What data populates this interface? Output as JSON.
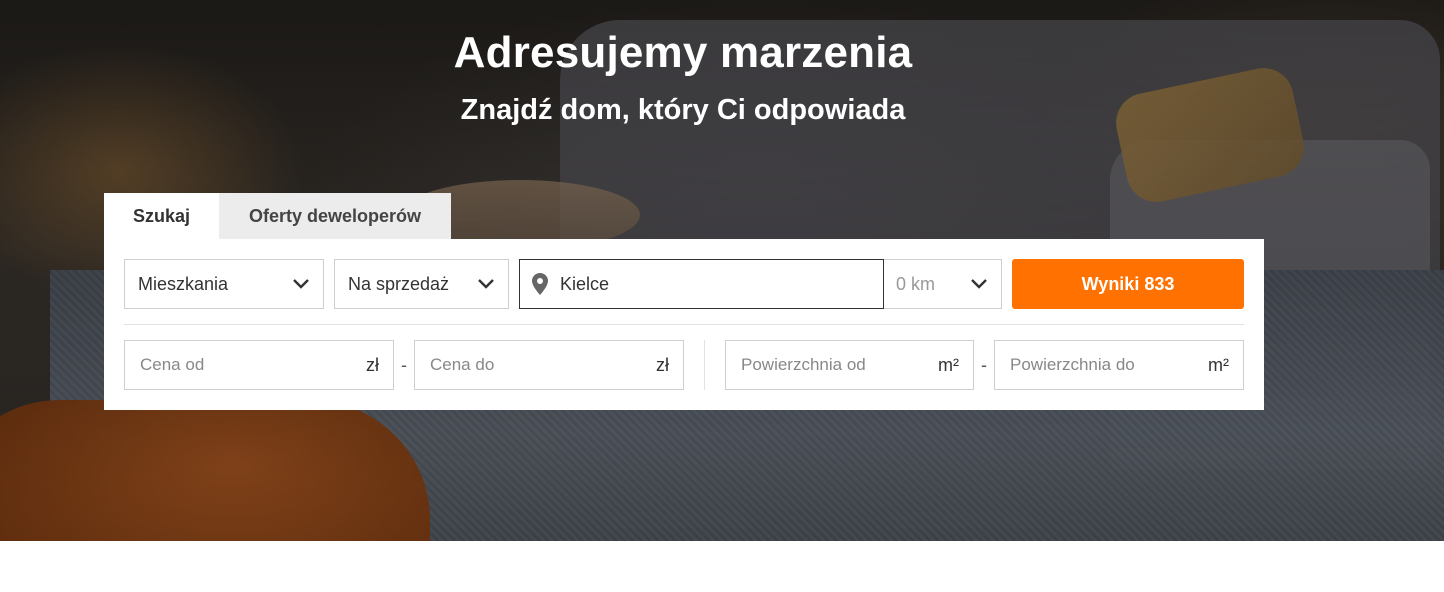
{
  "hero": {
    "title": "Adresujemy marzenia",
    "subtitle": "Znajdź dom, który Ci odpowiada"
  },
  "tabs": [
    {
      "label": "Szukaj",
      "active": true
    },
    {
      "label": "Oferty deweloperów",
      "active": false
    }
  ],
  "search": {
    "property_type": "Mieszkania",
    "transaction_type": "Na sprzedaż",
    "location_value": "Kielce",
    "distance": "0 km",
    "button_label": "Wyniki 833"
  },
  "filters": {
    "price_from_placeholder": "Cena od",
    "price_to_placeholder": "Cena do",
    "price_unit": "zł",
    "area_from_placeholder": "Powierzchnia od",
    "area_to_placeholder": "Powierzchnia do",
    "area_unit": "m²",
    "separator": "-"
  },
  "colors": {
    "accent": "#ff7100",
    "tab_inactive": "#ececec",
    "panel": "#ffffff"
  },
  "icons": {
    "chevron": "chevron-down-icon",
    "pin": "map-pin-icon"
  }
}
